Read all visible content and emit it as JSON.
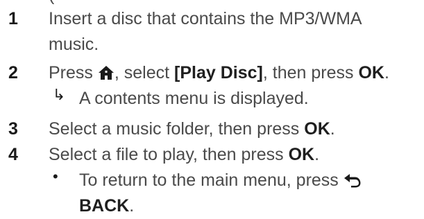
{
  "top_partial_text": "(",
  "steps": [
    {
      "number": "1",
      "line1": "Insert a disc that contains the MP3/WMA",
      "line2": "music."
    },
    {
      "number": "2",
      "text_a": "Press ",
      "icon": "home-icon",
      "text_b": ", select ",
      "menu_item": "[Play Disc]",
      "text_c": ", then press ",
      "key": "OK",
      "text_d": ".",
      "result_arrow": "↳",
      "result_text": "A contents menu is displayed."
    },
    {
      "number": "3",
      "text_a": "Select a music folder, then press ",
      "key": "OK",
      "text_b": "."
    },
    {
      "number": "4",
      "text_a": "Select a file to play, then press ",
      "key": "OK",
      "text_b": ".",
      "bullet": "•",
      "sub_text": "To return to the main menu, press ",
      "sub_icon": "back-icon",
      "sub_key": "BACK",
      "sub_end": "."
    }
  ],
  "colors": {
    "body_text": "#4a4a4a",
    "emphasis": "#1f1f1f",
    "background": "#ffffff"
  }
}
